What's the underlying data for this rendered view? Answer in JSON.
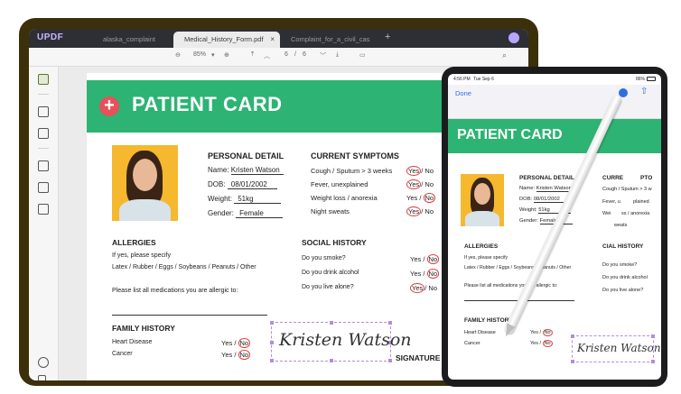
{
  "app": {
    "logo": "UPDF",
    "tabs": [
      {
        "label": "alaska_complaint"
      },
      {
        "label": "Medical_History_Form.pdf",
        "close": "×"
      },
      {
        "label": "Complaint_for_a_civil_cas"
      }
    ],
    "new_tab": "+"
  },
  "toolbar": {
    "zoom": "85%",
    "page_current": "6",
    "page_sep": "/",
    "page_total": "6"
  },
  "card": {
    "title": "PATIENT CARD",
    "personal_detail": {
      "heading": "PERSONAL DETAIL",
      "name_label": "Name:",
      "name_value": "Kristen Watson",
      "dob_label": "DOB:",
      "dob_value": "08/01/2002",
      "weight_label": "Weight:",
      "weight_value": "51kg",
      "gender_label": "Gender:",
      "gender_value": "Female"
    },
    "current_symptoms": {
      "heading": "CURRENT SYMPTOMS",
      "items": [
        {
          "label": "Cough / Sputum > 3 weeks",
          "yes": "Yes",
          "no": "No"
        },
        {
          "label": "Fever, unexplained",
          "yes": "Yes",
          "no": "No"
        },
        {
          "label": "Weight loss / anorexia",
          "yes": "Yes",
          "no": "No"
        },
        {
          "label": "Night sweats",
          "yes": "Yes",
          "no": "No"
        }
      ]
    },
    "allergies": {
      "heading": "ALLERGIES",
      "line1": "If yes, please specify",
      "line2": "Latex / Rubber / Eggs / Soybeans / Peanuts / Other",
      "line3": "Please list all medications you are allergic to:"
    },
    "social_history": {
      "heading": "SOCIAL HISTORY",
      "items": [
        {
          "label": "Do you smoke?",
          "yes": "Yes",
          "no": "No"
        },
        {
          "label": "Do you drink alcohol",
          "yes": "Yes",
          "no": "No"
        },
        {
          "label": "Do you live alone?",
          "yes": "Yes",
          "no": "No"
        }
      ]
    },
    "family_history": {
      "heading": "FAMILY HISTORY",
      "items": [
        {
          "label": "Heart Disease",
          "yes": "Yes",
          "no": "No"
        },
        {
          "label": "Cancer",
          "yes": "Yes",
          "no": "No"
        }
      ]
    },
    "signature_label": "SIGNATURE",
    "signature": "Kristen Watson"
  },
  "tablet": {
    "time": "4:56 PM",
    "date": "Tue Sep 6",
    "battery": "86%",
    "done": "Done",
    "title": "PATIENT CARD",
    "personal": {
      "heading": "PERSONAL DETAIL",
      "name": "Name:",
      "name_value": "Kristen Watson",
      "dob": "DOB:",
      "dob_value": "08/01/2002",
      "weight": "Weight:",
      "weight_value": "51kg",
      "gender": "Gender:",
      "gender_value": "Female"
    },
    "current_partial": "CURRE",
    "current_partial2": "PTO",
    "symptoms_partial": [
      "Cough / Sputum > 3 w",
      "Fever, u",
      "plained",
      "Wei",
      "ss / anorexia",
      "weats"
    ],
    "allergies": {
      "heading": "ALLERGIES",
      "line1": "If yes, please specify",
      "line2": "Latex / Rubber / Eggs / Soybeans / Peanuts / Other",
      "line3": "Please list all medications you are allergic to:"
    },
    "social_heading_partial": "CIAL HISTORY",
    "social_items": [
      "Do you smoke?",
      "Do you drink alcohol",
      "Do you live alone?"
    ],
    "family": {
      "heading": "FAMILY HISTORY",
      "items": [
        {
          "label": "Heart Disease",
          "yes": "Yes",
          "no": "No"
        },
        {
          "label": "Cancer",
          "yes": "Yes",
          "no": "No"
        }
      ]
    },
    "signature": "Kristen Watson"
  }
}
